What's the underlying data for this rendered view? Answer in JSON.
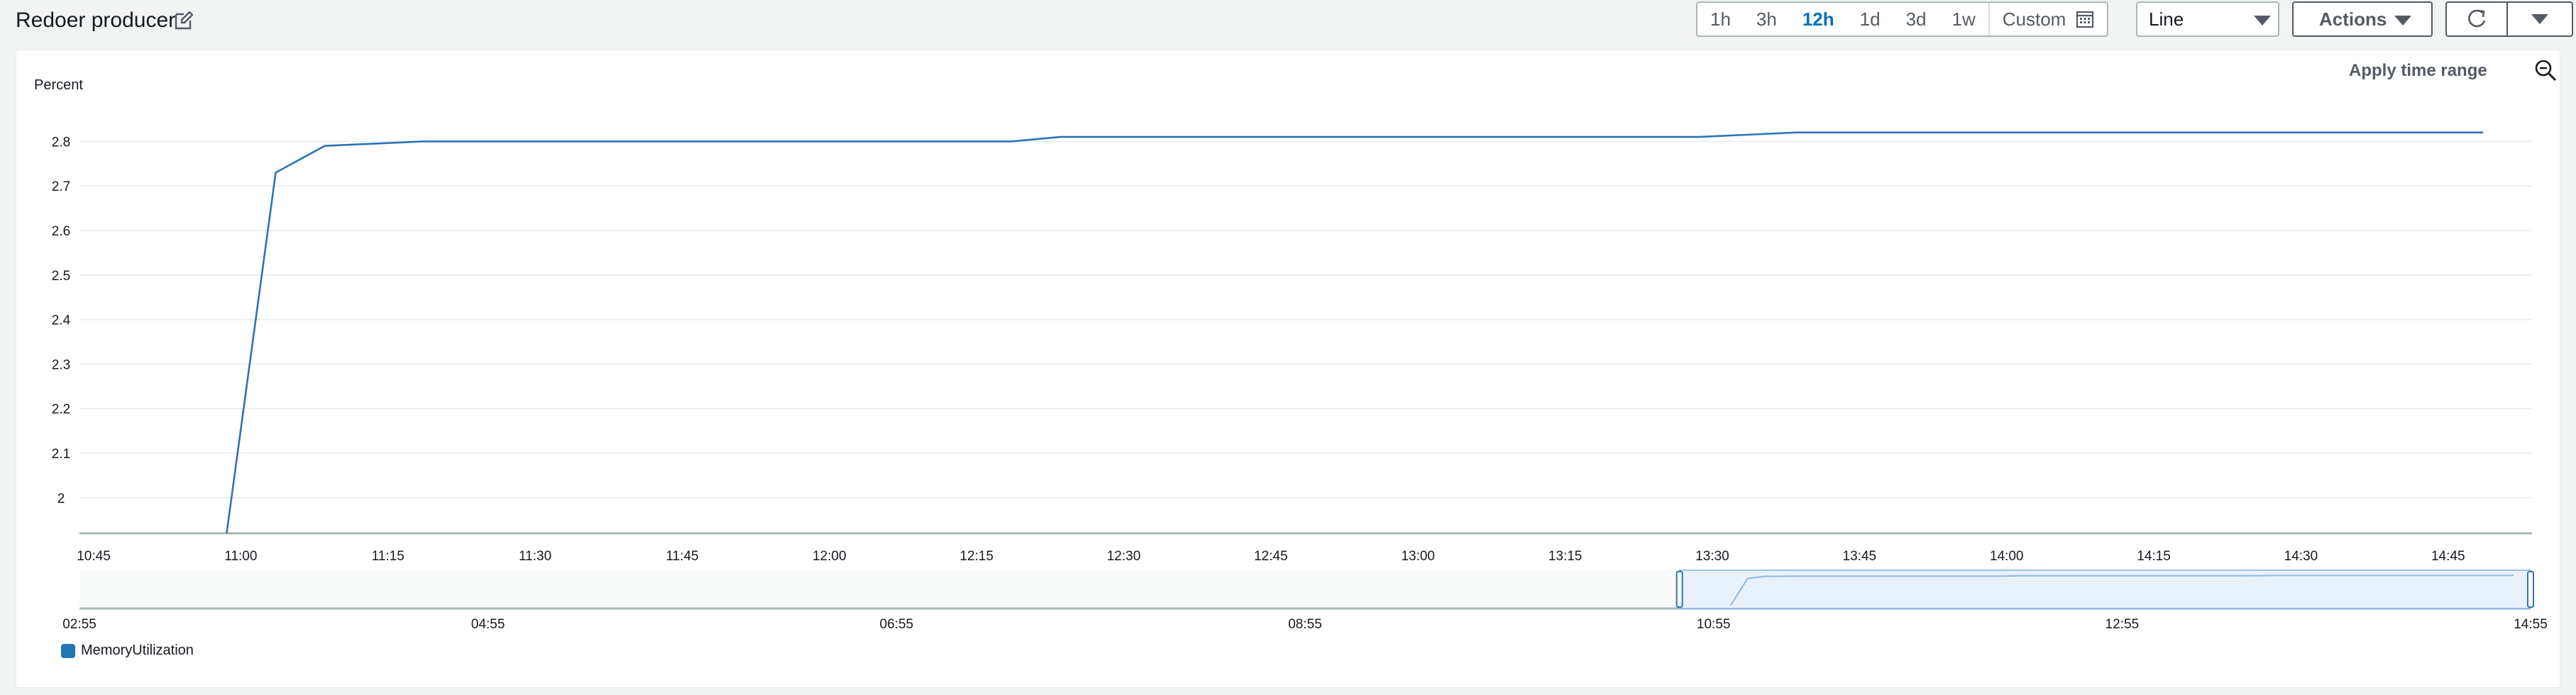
{
  "header": {
    "title": "Redoer producer",
    "time_ranges": [
      "1h",
      "3h",
      "12h",
      "1d",
      "3d",
      "1w"
    ],
    "active_range": "12h",
    "custom_label": "Custom",
    "chart_type_value": "Line",
    "actions_label": "Actions"
  },
  "panel": {
    "apply_time_range_label": "Apply time range"
  },
  "colors": {
    "series": "#2e73b8",
    "accent": "#0073bb",
    "navigator_fill": "#e9f2fc"
  },
  "chart_data": {
    "type": "line",
    "title": "",
    "ylabel": "Percent",
    "xlabel": "",
    "ylim": [
      1.92,
      2.85
    ],
    "yticks": [
      "2",
      "2.1",
      "2.2",
      "2.3",
      "2.4",
      "2.5",
      "2.6",
      "2.7",
      "2.8"
    ],
    "xlim": [
      "10:45",
      "14:55"
    ],
    "xticks": [
      "10:45",
      "11:00",
      "11:15",
      "11:30",
      "11:45",
      "12:00",
      "12:15",
      "12:30",
      "12:45",
      "13:00",
      "13:15",
      "13:30",
      "13:45",
      "14:00",
      "14:15",
      "14:30",
      "14:45"
    ],
    "grid": true,
    "series": [
      {
        "name": "MemoryUtilization",
        "x": [
          "11:00",
          "11:05",
          "11:10",
          "11:20",
          "12:20",
          "12:25",
          "12:30",
          "13:30",
          "13:35",
          "13:40",
          "14:50"
        ],
        "values": [
          1.92,
          2.73,
          2.79,
          2.8,
          2.8,
          2.81,
          2.81,
          2.81,
          2.815,
          2.82,
          2.82
        ]
      }
    ],
    "navigator": {
      "xlim": [
        "02:55",
        "14:55"
      ],
      "xticks": [
        "02:55",
        "04:55",
        "06:55",
        "08:55",
        "10:55",
        "12:55",
        "14:55"
      ],
      "selected_range": [
        "10:45",
        "14:55"
      ]
    },
    "legend": [
      "MemoryUtilization"
    ],
    "legend_position": "bottom-left"
  }
}
